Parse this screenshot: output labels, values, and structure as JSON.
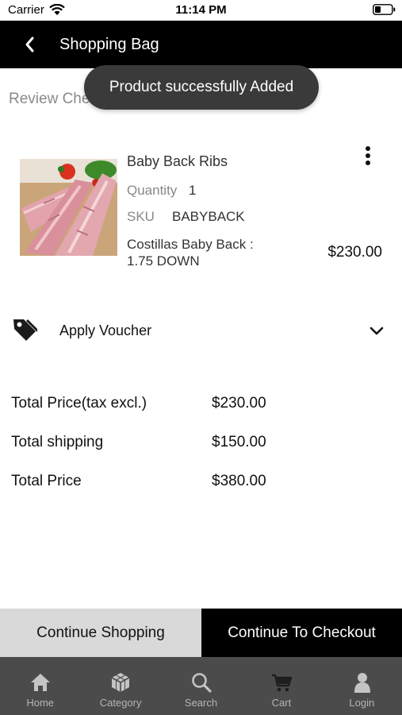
{
  "status_bar": {
    "carrier": "Carrier",
    "time": "11:14 PM"
  },
  "header": {
    "title": "Shopping Bag"
  },
  "review_label": "Review Che",
  "toast": "Product successfully Added",
  "cart_item": {
    "name": "Baby Back Ribs",
    "quantity_label": "Quantity",
    "quantity": "1",
    "sku_label": "SKU",
    "sku": "BABYBACK",
    "description_line1": "Costillas Baby Back :",
    "description_line2": "1.75 DOWN",
    "price": "$230.00"
  },
  "voucher": {
    "label": "Apply Voucher"
  },
  "totals": [
    {
      "label": "Total Price(tax excl.)",
      "value": "$230.00"
    },
    {
      "label": "Total shipping",
      "value": "$150.00"
    },
    {
      "label": "Total Price",
      "value": "$380.00"
    }
  ],
  "actions": {
    "continue_shopping": "Continue Shopping",
    "checkout": "Continue To Checkout"
  },
  "tabs": [
    {
      "label": "Home",
      "icon": "home-icon"
    },
    {
      "label": "Category",
      "icon": "category-icon"
    },
    {
      "label": "Search",
      "icon": "search-icon"
    },
    {
      "label": "Cart",
      "icon": "cart-icon"
    },
    {
      "label": "Login",
      "icon": "user-icon"
    }
  ],
  "colors": {
    "header_bg": "#000000",
    "toast_bg": "#3a3a3a",
    "tabbar_bg": "#4b4b4b",
    "continue_bg": "#d9d9d9",
    "checkout_bg": "#000000"
  }
}
